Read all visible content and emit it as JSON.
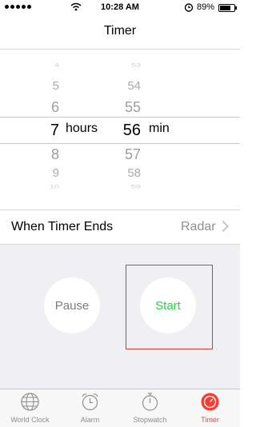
{
  "status_bar": {
    "time": "10:28 AM",
    "battery": "89%",
    "battery_level": 0.89
  },
  "header": {
    "title": "Timer"
  },
  "picker": {
    "hours": {
      "above": [
        "4",
        "5",
        "6"
      ],
      "selected": "7",
      "below": [
        "8",
        "9",
        "10"
      ],
      "unit": "hours"
    },
    "minutes": {
      "above": [
        "53",
        "54",
        "55"
      ],
      "selected": "56",
      "below": [
        "57",
        "58",
        "59"
      ],
      "unit": "min"
    }
  },
  "when_timer_ends": {
    "label": "When Timer Ends",
    "value": "Radar"
  },
  "buttons": {
    "pause": "Pause",
    "start": "Start"
  },
  "tabbar": {
    "tabs": [
      {
        "label": "World Clock",
        "icon": "globe-icon"
      },
      {
        "label": "Alarm",
        "icon": "alarm-clock-icon"
      },
      {
        "label": "Stopwatch",
        "icon": "stopwatch-icon"
      },
      {
        "label": "Timer",
        "icon": "timer-icon",
        "active": true
      }
    ]
  },
  "colors": {
    "accent_red": "#ff3b30",
    "start_green": "#2fcf4a",
    "background_gray": "#efeff4"
  }
}
